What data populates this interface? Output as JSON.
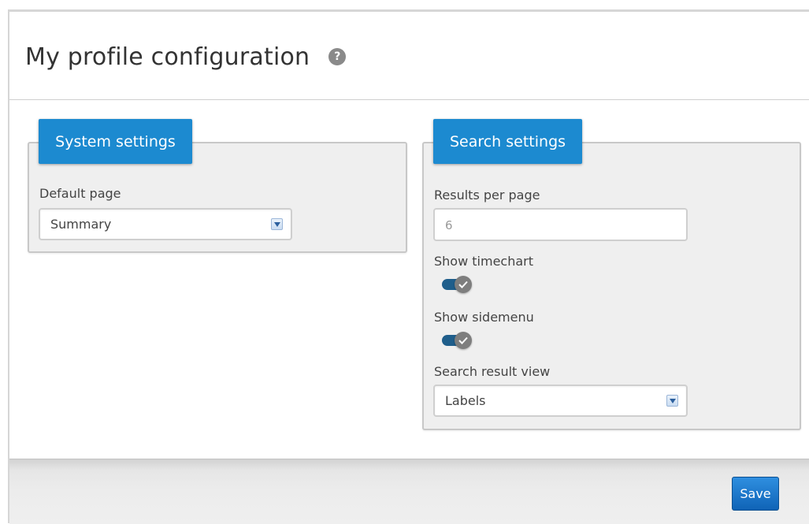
{
  "page": {
    "title": "My profile configuration",
    "help_icon": "question-mark-circle-icon"
  },
  "system_settings": {
    "legend": "System settings",
    "default_page": {
      "label": "Default page",
      "value": "Summary"
    }
  },
  "search_settings": {
    "legend": "Search settings",
    "results_per_page": {
      "label": "Results per page",
      "value": "6"
    },
    "show_timechart": {
      "label": "Show timechart",
      "enabled": true
    },
    "show_sidemenu": {
      "label": "Show sidemenu",
      "enabled": true
    },
    "search_result_view": {
      "label": "Search result view",
      "value": "Labels"
    }
  },
  "footer": {
    "save_label": "Save"
  },
  "colors": {
    "accent": "#1c8ad0",
    "toggle_on": "#1f5e8b",
    "save": "#1c74c8"
  }
}
